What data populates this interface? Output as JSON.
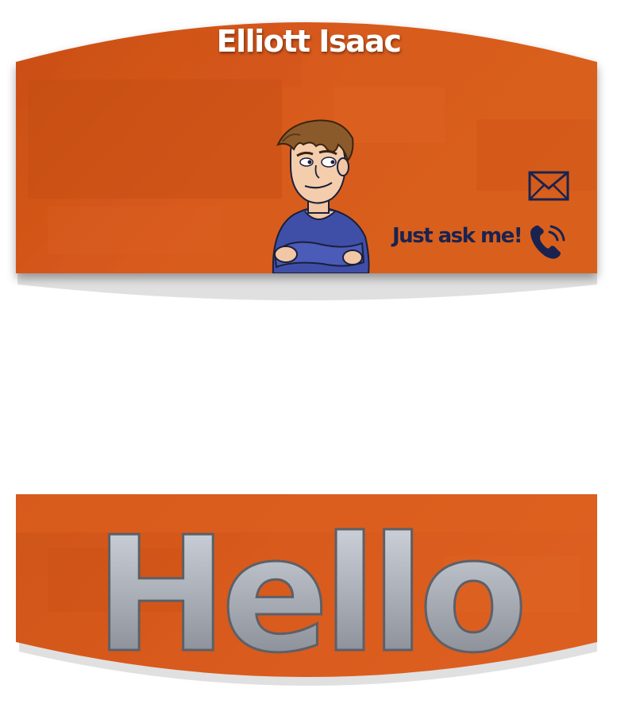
{
  "badge": {
    "name": "Elliott Isaac",
    "tagline": "Just ask me!",
    "greeting": "Hello"
  },
  "icons": {
    "email": "envelope-icon",
    "phone": "phone-icon",
    "avatar": "cartoon-portrait"
  },
  "colors": {
    "band_orange": "#d85a1c",
    "band_orange_dark": "#c44d12",
    "name_text": "#ffffff",
    "tagline_text": "#1a2350",
    "icon_color": "#1a2350",
    "hello_metal_light": "#c9ced6",
    "hello_metal_dark": "#7c8089"
  }
}
